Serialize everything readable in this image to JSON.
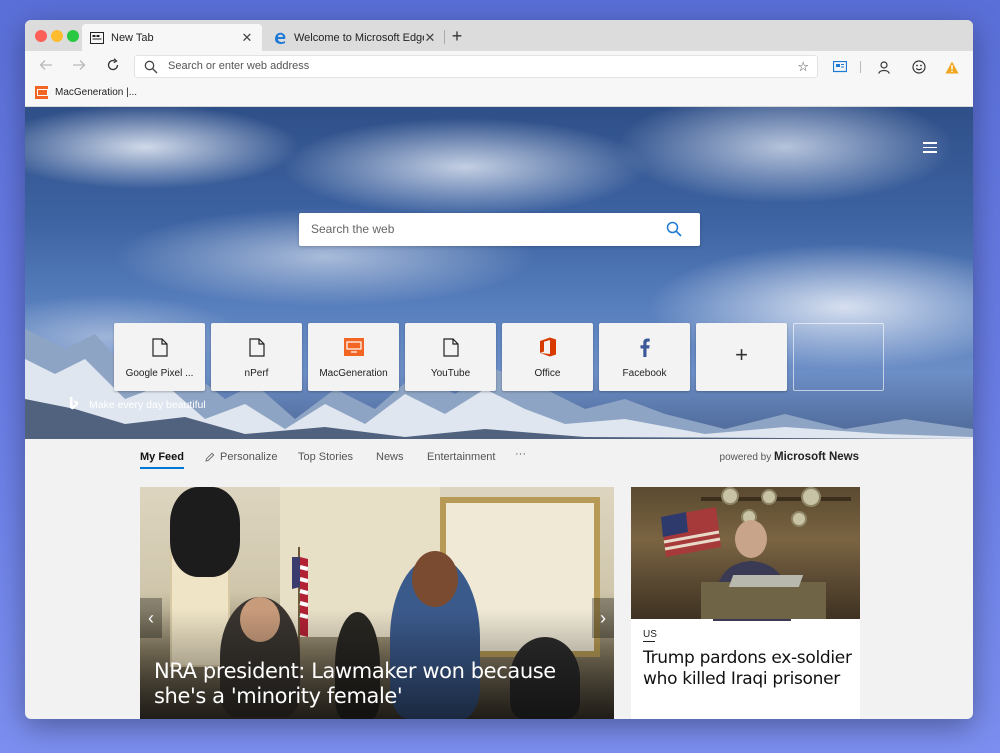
{
  "tabs": [
    {
      "label": "New Tab",
      "icon": "newtab-icon",
      "active": true
    },
    {
      "label": "Welcome to Microsoft Edge Canary",
      "icon": "edge-icon",
      "active": false
    }
  ],
  "toolbar": {
    "address_placeholder": "Search or enter web address"
  },
  "favorites": [
    {
      "label": "MacGeneration |..."
    }
  ],
  "hero": {
    "search_placeholder": "Search the web",
    "tagline": "Make every day beautiful",
    "tiles": [
      {
        "label": "Google Pixel ...",
        "icon": "page-icon"
      },
      {
        "label": "nPerf",
        "icon": "page-icon"
      },
      {
        "label": "MacGeneration",
        "icon": "macgeneration-icon"
      },
      {
        "label": "YouTube",
        "icon": "page-icon"
      },
      {
        "label": "Office",
        "icon": "office-icon"
      },
      {
        "label": "Facebook",
        "icon": "facebook-icon"
      },
      {
        "label": "+",
        "icon": "add-icon"
      }
    ]
  },
  "feed": {
    "nav": [
      "My Feed",
      "Personalize",
      "Top Stories",
      "News",
      "Entertainment",
      "···"
    ],
    "powered_by": "powered by",
    "powered_brand": "Microsoft News",
    "main_story": {
      "headline": "NRA president: Lawmaker won because she's a 'minority female'"
    },
    "side_story": {
      "tag": "US",
      "headline": "Trump pardons ex-soldier who killed Iraqi prisoner"
    }
  },
  "colors": {
    "accent": "#0078d7",
    "office": "#d83b01",
    "facebook": "#3b5998",
    "macgen": "#f26522"
  }
}
